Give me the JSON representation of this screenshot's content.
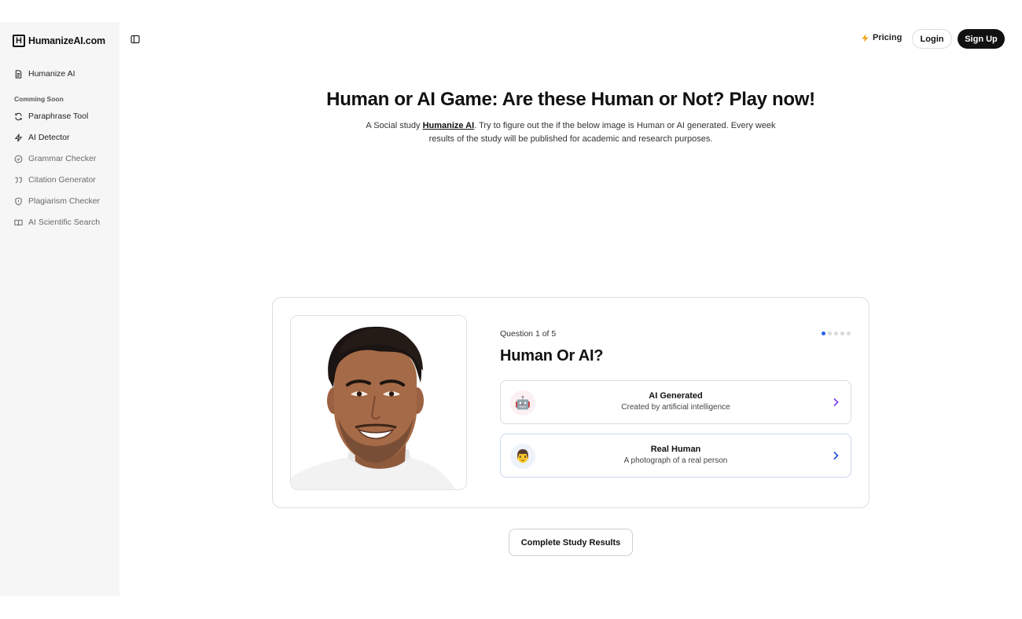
{
  "brand": {
    "logo_letter": "H",
    "name": "HumanizeAI.com"
  },
  "sidebar": {
    "primary": {
      "label": "Humanize AI",
      "icon": "document-icon"
    },
    "section_label": "Comming Soon",
    "items": [
      {
        "label": "Paraphrase Tool",
        "icon": "refresh-icon"
      },
      {
        "label": "AI Detector",
        "icon": "bolt-icon"
      },
      {
        "label": "Grammar Checker",
        "icon": "check-circle-icon"
      },
      {
        "label": "Citation Generator",
        "icon": "quote-icon"
      },
      {
        "label": "Plagiarism Checker",
        "icon": "shield-icon"
      },
      {
        "label": "AI Scientific Search",
        "icon": "book-icon"
      }
    ]
  },
  "header": {
    "pricing_label": "Pricing",
    "login_label": "Login",
    "signup_label": "Sign Up"
  },
  "hero": {
    "title": "Human or AI Game: Are these Human or Not? Play now!",
    "desc_prefix": "A Social study ",
    "desc_link": "Humanize AI",
    "desc_suffix": ". Try to figure out the if the below image is Human or AI generated. Every week results of the study will be published for academic and research purposes."
  },
  "quiz": {
    "question_count": "Question 1 of 5",
    "current_question": 1,
    "total_questions": 5,
    "question": "Human Or AI?",
    "options": [
      {
        "title": "AI Generated",
        "subtitle": "Created by artificial intelligence",
        "emoji": "🤖"
      },
      {
        "title": "Real Human",
        "subtitle": "A photograph of a real person",
        "emoji": "👨"
      }
    ]
  },
  "footer_button": "Complete Study Results",
  "colors": {
    "accent": "#2563eb",
    "dark": "#111111",
    "sidebar_bg": "#f6f6f6",
    "pricing_bolt": "#f59e0b",
    "ai_chevron": "#7c3aed",
    "human_chevron": "#1d4ed8"
  }
}
